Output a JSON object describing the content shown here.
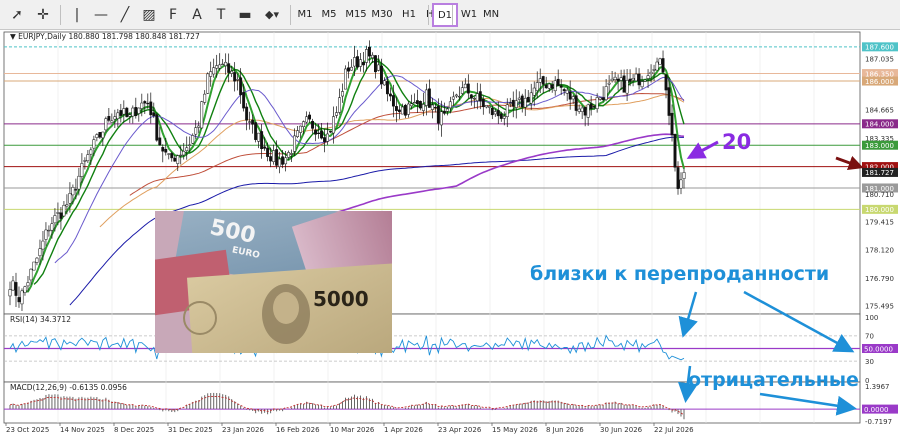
{
  "toolbar": {
    "tools": [
      {
        "name": "cursor-icon",
        "glyph": "➚"
      },
      {
        "name": "crosshair-icon",
        "glyph": "✛"
      },
      {
        "name": "vertical-line-icon",
        "glyph": "|"
      },
      {
        "name": "horizontal-line-icon",
        "glyph": "—"
      },
      {
        "name": "trend-line-icon",
        "glyph": "╱"
      },
      {
        "name": "channel-icon",
        "glyph": "▨"
      },
      {
        "name": "fibonacci-icon",
        "glyph": "F"
      },
      {
        "name": "text-icon",
        "glyph": "A"
      },
      {
        "name": "text-label-icon",
        "glyph": "T"
      },
      {
        "name": "rectangle-label-icon",
        "glyph": "▬"
      },
      {
        "name": "shapes-icon",
        "glyph": "◆▾"
      }
    ],
    "timeframes": [
      "M1",
      "M5",
      "M15",
      "M30",
      "H1",
      "H4",
      "D1",
      "W1",
      "MN"
    ],
    "active_timeframe": "D1"
  },
  "chart_header": {
    "symbol": "EURJPY,Daily",
    "ohlc": "180.880 181.798 180.848 181.727"
  },
  "price_axis": {
    "labels": [
      "187.600",
      "187.035",
      "186.350",
      "186.000",
      "184.665",
      "184.000",
      "183.335",
      "183.000",
      "182.000",
      "181.727",
      "181.000",
      "180.710",
      "180.000",
      "179.415",
      "178.120",
      "176.790",
      "175.495"
    ],
    "highlighted": [
      {
        "value": "187.600",
        "color": "#4fc3c8"
      },
      {
        "value": "186.350",
        "color": "#e8b89a"
      },
      {
        "value": "186.000",
        "color": "#d8a878"
      },
      {
        "value": "184.000",
        "color": "#8a2a8a"
      },
      {
        "value": "183.000",
        "color": "#3c9a3c"
      },
      {
        "value": "182.000",
        "color": "#a01010"
      },
      {
        "value": "181.727",
        "color": "#222222"
      },
      {
        "value": "181.000",
        "color": "#9a9a9a"
      },
      {
        "value": "180.000",
        "color": "#c8d870"
      }
    ]
  },
  "date_axis": [
    "23 Oct 2025",
    "14 Nov 2025",
    "8 Dec 2025",
    "31 Dec 2025",
    "23 Jan 2026",
    "16 Feb 2026",
    "10 Mar 2026",
    "1 Apr 2026",
    "23 Apr 2026",
    "15 May 2026",
    "8 Jun 2026",
    "30 Jun 2026",
    "22 Jul 2026"
  ],
  "rsi": {
    "header": "RSI(14) 34.3712",
    "axis_labels": [
      "100",
      "70",
      "50.0000",
      "30",
      "0"
    ]
  },
  "macd": {
    "header": "MACD(12,26,9) -0.6135 0.0956",
    "axis_labels": [
      "1.3967",
      "0.0000",
      "-0.7197"
    ]
  },
  "annotations": {
    "number": "20",
    "oversold_text": "близки к перепроданности",
    "negative_text": "отрицательные"
  },
  "inset_image": {
    "banknotes": [
      "500",
      "EURO",
      "5000"
    ]
  },
  "chart_data": {
    "type": "candlestick",
    "symbol": "EURJPY",
    "timeframe": "Daily",
    "x_range": [
      "23 Oct 2025",
      "late Jul 2026"
    ],
    "y_range": [
      175.2,
      188.2
    ],
    "close_path": [
      [
        0,
        176.6
      ],
      [
        10,
        175.8
      ],
      [
        20,
        176.9
      ],
      [
        30,
        178.0
      ],
      [
        40,
        179.3
      ],
      [
        50,
        179.8
      ],
      [
        60,
        180.4
      ],
      [
        70,
        181.6
      ],
      [
        80,
        182.6
      ],
      [
        90,
        183.4
      ],
      [
        100,
        184.3
      ],
      [
        110,
        184.6
      ],
      [
        120,
        184.2
      ],
      [
        130,
        184.9
      ],
      [
        140,
        185.0
      ],
      [
        150,
        183.2
      ],
      [
        160,
        182.3
      ],
      [
        170,
        182.6
      ],
      [
        180,
        183.0
      ],
      [
        190,
        184.0
      ],
      [
        200,
        186.2
      ],
      [
        210,
        186.8
      ],
      [
        220,
        186.5
      ],
      [
        230,
        186.0
      ],
      [
        240,
        184.0
      ],
      [
        250,
        183.4
      ],
      [
        260,
        182.7
      ],
      [
        270,
        182.2
      ],
      [
        280,
        182.5
      ],
      [
        290,
        183.4
      ],
      [
        300,
        184.1
      ],
      [
        310,
        183.8
      ],
      [
        320,
        183.4
      ],
      [
        330,
        184.6
      ],
      [
        340,
        186.6
      ],
      [
        350,
        186.9
      ],
      [
        360,
        187.2
      ],
      [
        370,
        186.7
      ],
      [
        380,
        185.4
      ],
      [
        390,
        184.8
      ],
      [
        400,
        184.7
      ],
      [
        410,
        184.9
      ],
      [
        420,
        185.3
      ],
      [
        430,
        184.4
      ],
      [
        440,
        184.2
      ],
      [
        450,
        185.4
      ],
      [
        460,
        185.6
      ],
      [
        470,
        185.2
      ],
      [
        480,
        184.8
      ],
      [
        490,
        184.4
      ],
      [
        500,
        184.5
      ],
      [
        510,
        184.8
      ],
      [
        520,
        185.1
      ],
      [
        530,
        185.7
      ],
      [
        540,
        185.9
      ],
      [
        550,
        185.9
      ],
      [
        560,
        185.5
      ],
      [
        570,
        185.0
      ],
      [
        580,
        184.6
      ],
      [
        590,
        185.0
      ],
      [
        600,
        185.5
      ],
      [
        610,
        185.9
      ],
      [
        620,
        185.8
      ],
      [
        630,
        186.0
      ],
      [
        640,
        186.3
      ],
      [
        650,
        186.9
      ],
      [
        660,
        186.6
      ],
      [
        670,
        182.5
      ],
      [
        675,
        180.6
      ],
      [
        680,
        181.7
      ]
    ],
    "horizontal_levels": [
      187.6,
      186.35,
      186.0,
      184.0,
      183.0,
      182.0,
      181.0,
      180.0
    ],
    "rsi": {
      "period": 14,
      "value": 34.3712,
      "levels": [
        70,
        50,
        30
      ]
    },
    "macd": {
      "params": [
        12,
        26,
        9
      ],
      "main": -0.6135,
      "signal": 0.0956
    }
  }
}
